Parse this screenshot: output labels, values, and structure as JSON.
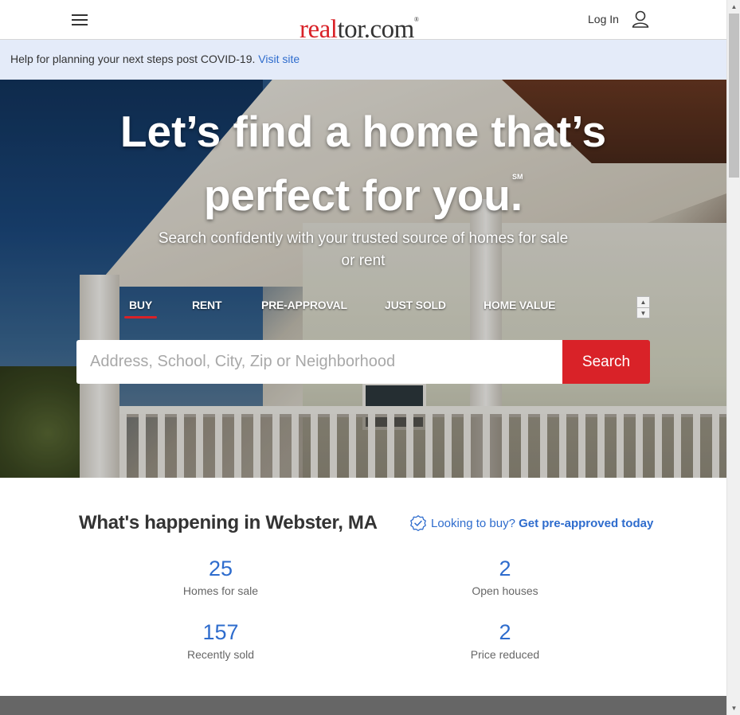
{
  "header": {
    "logo_real": "real",
    "logo_rest": "tor.com",
    "logo_reg": "®",
    "login_label": "Log In"
  },
  "banner": {
    "text": "Help for planning your next steps post COVID-19.",
    "link": "Visit site"
  },
  "hero": {
    "title_line1": "Let’s find a home that’s",
    "title_line2": "perfect for you.",
    "service_mark": "SM",
    "subtitle": "Search confidently with your trusted source of homes for sale or rent",
    "tabs": [
      {
        "label": "BUY",
        "active": true
      },
      {
        "label": "RENT",
        "active": false
      },
      {
        "label": "PRE-APPROVAL",
        "active": false
      },
      {
        "label": "JUST SOLD",
        "active": false
      },
      {
        "label": "HOME VALUE",
        "active": false
      }
    ],
    "search_placeholder": "Address, School, City, Zip or Neighborhood",
    "search_button": "Search"
  },
  "stats": {
    "title": "What's happening in Webster, MA",
    "preapproval_prefix": "Looking to buy?",
    "preapproval_link": "Get pre-approved today",
    "items": [
      {
        "value": "25",
        "label": "Homes for sale"
      },
      {
        "value": "2",
        "label": "Open houses"
      },
      {
        "value": "157",
        "label": "Recently sold"
      },
      {
        "value": "2",
        "label": "Price reduced"
      }
    ]
  },
  "colors": {
    "brand_red": "#d92228",
    "link_blue": "#2e6ccd",
    "banner_bg": "#e4ebf9"
  },
  "icons": {
    "menu": "hamburger-icon",
    "user": "user-icon",
    "badge": "verified-badge-icon",
    "scroll_up": "triangle-up-icon",
    "scroll_down": "triangle-down-icon"
  }
}
